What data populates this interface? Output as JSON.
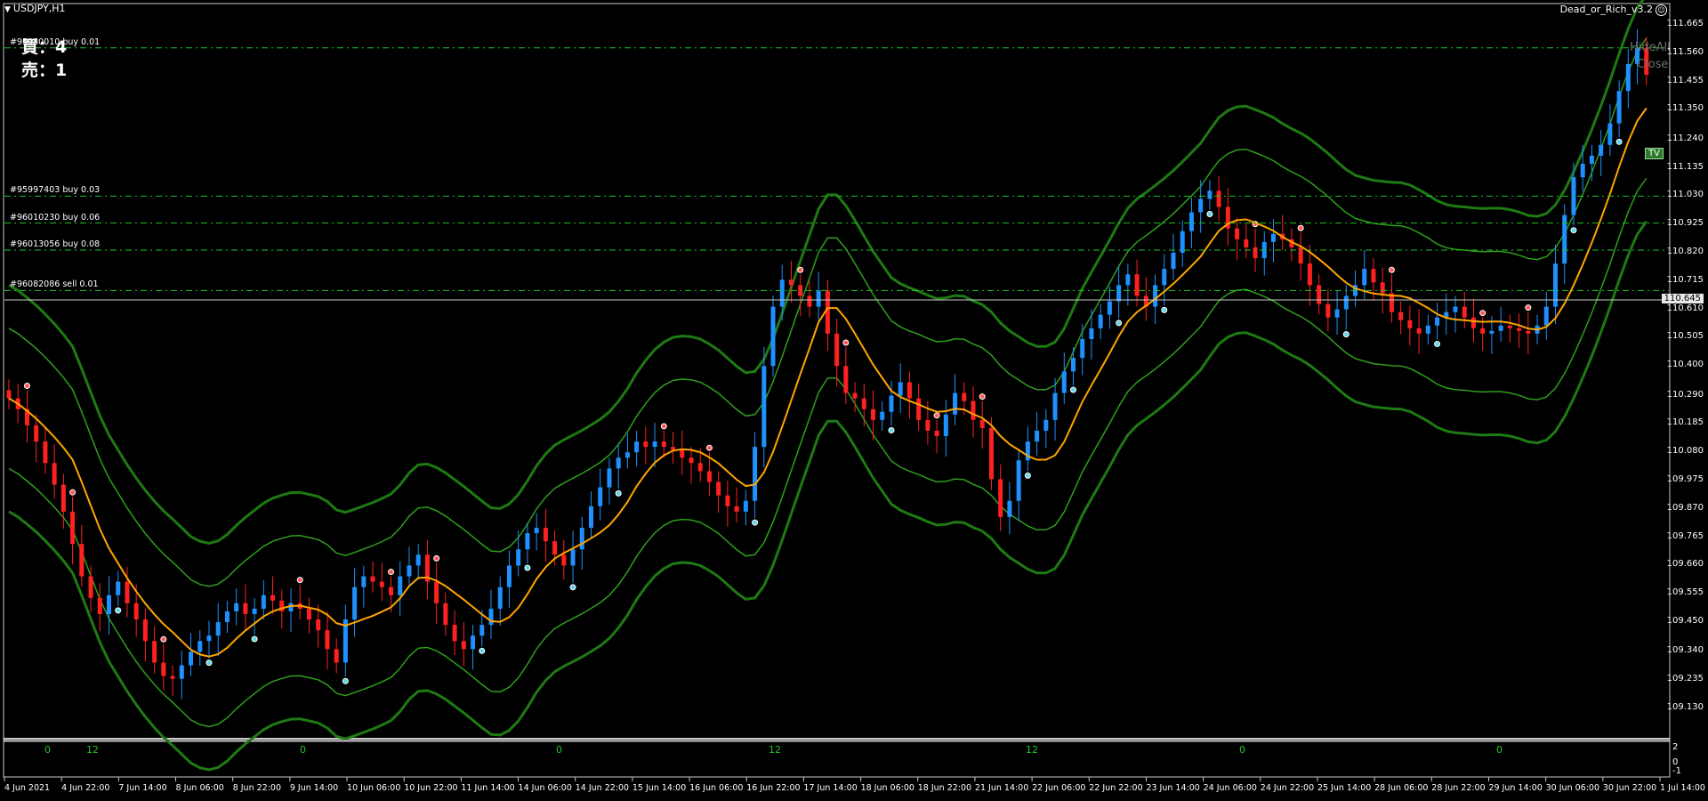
{
  "chart": {
    "symbol_title": "USDJPY,H1",
    "ea_name": "Dead_or_Rich_v3.2",
    "ea_icon": "smiley-icon"
  },
  "stats": {
    "buy_text": "買：4",
    "sell_text": "売：1"
  },
  "orders": [
    {
      "label": "#95980010 buy 0.01",
      "price": 111.58
    },
    {
      "label": "#95997403 buy 0.03",
      "price": 111.03
    },
    {
      "label": "#96010230 buy 0.06",
      "price": 110.93
    },
    {
      "label": "#96013056 buy 0.08",
      "price": 110.83
    },
    {
      "label": "#96082086 sell 0.01",
      "price": 110.68
    }
  ],
  "controls": {
    "hide_all": "HideAll",
    "close": "Close",
    "tv": "TV"
  },
  "price_axis": {
    "ticks": [
      "111.665",
      "111.560",
      "111.455",
      "111.350",
      "111.240",
      "111.135",
      "111.030",
      "110.925",
      "110.820",
      "110.715",
      "110.610",
      "110.505",
      "110.400",
      "110.290",
      "110.185",
      "110.080",
      "109.975",
      "109.870",
      "109.765",
      "109.660",
      "109.555",
      "109.450",
      "109.340",
      "109.235",
      "109.130"
    ],
    "current_price": "110.645",
    "ymin": 109.13,
    "ymax": 111.665
  },
  "time_axis": {
    "labels": [
      "4 Jun 2021",
      "4 Jun 22:00",
      "7 Jun 14:00",
      "8 Jun 06:00",
      "8 Jun 22:00",
      "9 Jun 14:00",
      "10 Jun 06:00",
      "10 Jun 22:00",
      "11 Jun 14:00",
      "14 Jun 06:00",
      "14 Jun 22:00",
      "15 Jun 14:00",
      "16 Jun 06:00",
      "16 Jun 22:00",
      "17 Jun 14:00",
      "18 Jun 06:00",
      "18 Jun 22:00",
      "21 Jun 14:00",
      "22 Jun 06:00",
      "22 Jun 22:00",
      "23 Jun 14:00",
      "24 Jun 06:00",
      "24 Jun 22:00",
      "25 Jun 14:00",
      "28 Jun 06:00",
      "28 Jun 22:00",
      "29 Jun 14:00",
      "30 Jun 06:00",
      "30 Jun 22:00",
      "1 Jul 14:00"
    ]
  },
  "sub_window": {
    "labels": [
      "0",
      "12",
      "0",
      "0",
      "12",
      "12",
      "0",
      "0"
    ],
    "scale_top": "2",
    "scale_zero": "0",
    "scale_bottom": "-1"
  },
  "colors": {
    "background": "#000000",
    "bull": "#1e90ff",
    "bear": "#ff2020",
    "moving_average": "#ffa500",
    "envelope_outer": "#1e7a12",
    "envelope_inner": "#2e9e1c",
    "order_line": "#22c322",
    "text": "#ffffff"
  },
  "chart_data": {
    "type": "candlestick",
    "ylim": [
      109.13,
      111.665
    ],
    "close": [
      110.28,
      110.24,
      110.18,
      110.12,
      110.04,
      109.96,
      109.86,
      109.74,
      109.62,
      109.54,
      109.48,
      109.55,
      109.6,
      109.52,
      109.46,
      109.38,
      109.3,
      109.25,
      109.24,
      109.29,
      109.34,
      109.38,
      109.4,
      109.45,
      109.49,
      109.52,
      109.48,
      109.5,
      109.55,
      109.53,
      109.49,
      109.52,
      109.5,
      109.46,
      109.42,
      109.35,
      109.3,
      109.46,
      109.58,
      109.62,
      109.6,
      109.58,
      109.55,
      109.62,
      109.66,
      109.7,
      109.6,
      109.52,
      109.44,
      109.38,
      109.35,
      109.4,
      109.44,
      109.5,
      109.58,
      109.66,
      109.72,
      109.78,
      109.8,
      109.75,
      109.7,
      109.66,
      109.72,
      109.8,
      109.88,
      109.95,
      110.02,
      110.06,
      110.08,
      110.12,
      110.1,
      110.12,
      110.1,
      110.09,
      110.06,
      110.04,
      110.01,
      109.97,
      109.92,
      109.88,
      109.86,
      109.9,
      110.1,
      110.4,
      110.62,
      110.72,
      110.7,
      110.66,
      110.62,
      110.68,
      110.52,
      110.4,
      110.3,
      110.28,
      110.24,
      110.2,
      110.23,
      110.29,
      110.34,
      110.28,
      110.2,
      110.16,
      110.14,
      110.22,
      110.3,
      110.27,
      110.2,
      110.17,
      109.98,
      109.84,
      109.9,
      110.05,
      110.12,
      110.16,
      110.2,
      110.3,
      110.38,
      110.43,
      110.5,
      110.54,
      110.59,
      110.64,
      110.7,
      110.74,
      110.66,
      110.62,
      110.7,
      110.76,
      110.82,
      110.9,
      110.97,
      111.02,
      111.05,
      110.99,
      110.91,
      110.87,
      110.84,
      110.8,
      110.86,
      110.89,
      110.87,
      110.84,
      110.78,
      110.7,
      110.63,
      110.58,
      110.61,
      110.66,
      110.7,
      110.76,
      110.71,
      110.67,
      110.6,
      110.57,
      110.54,
      110.52,
      110.55,
      110.58,
      110.6,
      110.62,
      110.58,
      110.54,
      110.52,
      110.53,
      110.55,
      110.54,
      110.53,
      110.52,
      110.55,
      110.62,
      110.78,
      110.96,
      111.1,
      111.15,
      111.18,
      111.22,
      111.3,
      111.42,
      111.52,
      111.58,
      111.48
    ]
  }
}
